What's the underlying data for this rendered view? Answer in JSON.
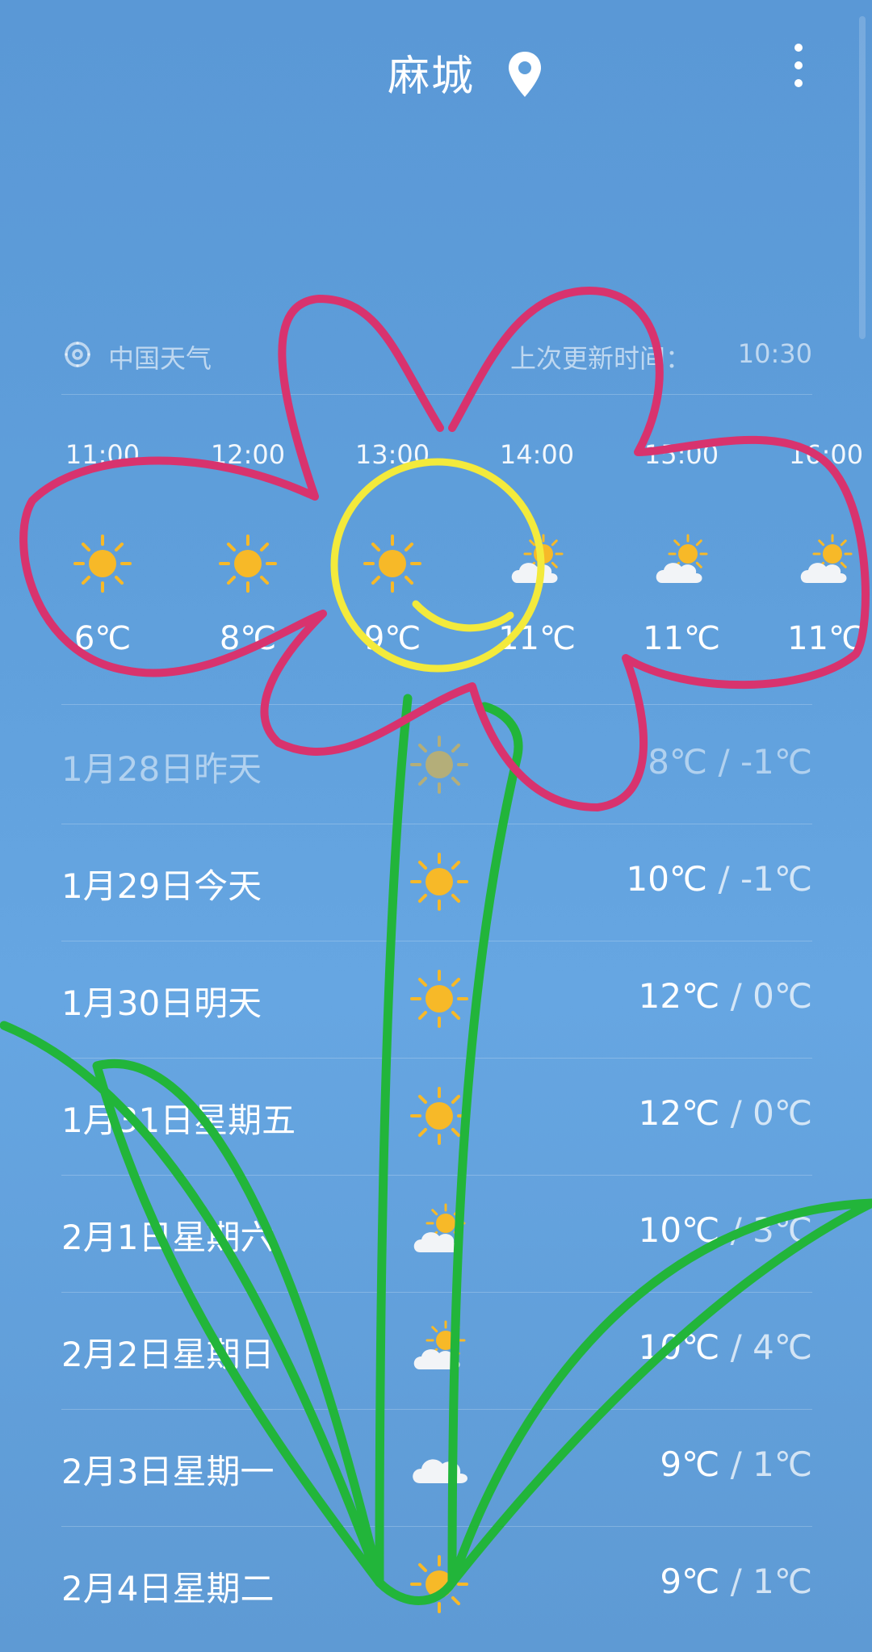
{
  "header": {
    "city": "麻城",
    "location_icon": "location-pin-icon",
    "menu_icon": "more-vert-icon"
  },
  "source": {
    "label": "中国天气",
    "icon": "china-weather-logo-icon",
    "update_prefix": "上次更新时间：",
    "update_time": "10:30"
  },
  "hourly": [
    {
      "time": "11:00",
      "icon": "sunny-icon",
      "temp": "6℃"
    },
    {
      "time": "12:00",
      "icon": "sunny-icon",
      "temp": "8℃"
    },
    {
      "time": "13:00",
      "icon": "sunny-icon",
      "temp": "9℃"
    },
    {
      "time": "14:00",
      "icon": "partly-cloudy-icon",
      "temp": "11℃"
    },
    {
      "time": "15:00",
      "icon": "partly-cloudy-icon",
      "temp": "11℃"
    },
    {
      "time": "16:00",
      "icon": "partly-cloudy-icon",
      "temp": "11℃"
    }
  ],
  "daily": [
    {
      "date": "1月28日昨天",
      "icon": "sunny-icon",
      "high": "8℃",
      "low": "-1℃",
      "past": true
    },
    {
      "date": "1月29日今天",
      "icon": "sunny-icon",
      "high": "10℃",
      "low": "-1℃"
    },
    {
      "date": "1月30日明天",
      "icon": "sunny-icon",
      "high": "12℃",
      "low": "0℃"
    },
    {
      "date": "1月31日星期五",
      "icon": "sunny-icon",
      "high": "12℃",
      "low": "0℃"
    },
    {
      "date": "2月1日星期六",
      "icon": "partly-cloudy-icon",
      "high": "10℃",
      "low": "3℃"
    },
    {
      "date": "2月2日星期日",
      "icon": "partly-cloudy-icon",
      "high": "10℃",
      "low": "4℃"
    },
    {
      "date": "2月3日星期一",
      "icon": "cloudy-icon",
      "high": "9℃",
      "low": "1℃"
    },
    {
      "date": "2月4日星期二",
      "icon": "sunny-icon",
      "high": "9℃",
      "low": "1℃"
    }
  ],
  "temp_separator": " / ",
  "colors": {
    "petal": "#d8336e",
    "face": "#f3ea3c",
    "stem": "#22b53a",
    "sun": "#f7b928"
  }
}
